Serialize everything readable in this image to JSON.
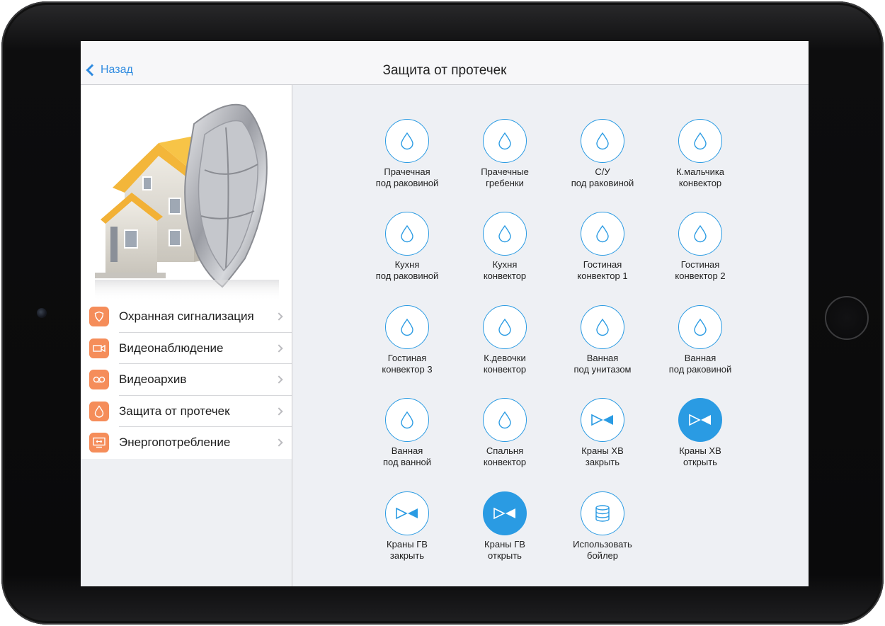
{
  "navbar": {
    "back_label": "Назад",
    "title": "Защита от протечек"
  },
  "sidebar": {
    "items": [
      {
        "label": "Охранная сигнализация",
        "icon": "shield-icon"
      },
      {
        "label": "Видеонаблюдение",
        "icon": "video-camera-icon"
      },
      {
        "label": "Видеоархив",
        "icon": "tape-icon"
      },
      {
        "label": "Защита от протечек",
        "icon": "water-drop-icon"
      },
      {
        "label": "Энергопотребление",
        "icon": "monitor-icon"
      }
    ]
  },
  "tiles": [
    {
      "line1": "Прачечная",
      "line2": "под раковиной",
      "icon": "water-drop-icon",
      "active": false
    },
    {
      "line1": "Прачечные",
      "line2": "гребенки",
      "icon": "water-drop-icon",
      "active": false
    },
    {
      "line1": "С/У",
      "line2": "под раковиной",
      "icon": "water-drop-icon",
      "active": false
    },
    {
      "line1": "К.мальчика",
      "line2": "конвектор",
      "icon": "water-drop-icon",
      "active": false
    },
    {
      "line1": "Кухня",
      "line2": "под раковиной",
      "icon": "water-drop-icon",
      "active": false
    },
    {
      "line1": "Кухня",
      "line2": "конвектор",
      "icon": "water-drop-icon",
      "active": false
    },
    {
      "line1": "Гостиная",
      "line2": "конвектор 1",
      "icon": "water-drop-icon",
      "active": false
    },
    {
      "line1": "Гостиная",
      "line2": "конвектор 2",
      "icon": "water-drop-icon",
      "active": false
    },
    {
      "line1": "Гостиная",
      "line2": "конвектор 3",
      "icon": "water-drop-icon",
      "active": false
    },
    {
      "line1": "К.девочки",
      "line2": "конвектор",
      "icon": "water-drop-icon",
      "active": false
    },
    {
      "line1": "Ванная",
      "line2": "под унитазом",
      "icon": "water-drop-icon",
      "active": false
    },
    {
      "line1": "Ванная",
      "line2": "под раковиной",
      "icon": "water-drop-icon",
      "active": false
    },
    {
      "line1": "Ванная",
      "line2": "под ванной",
      "icon": "water-drop-icon",
      "active": false
    },
    {
      "line1": "Спальня",
      "line2": "конвектор",
      "icon": "water-drop-icon",
      "active": false
    },
    {
      "line1": "Краны ХВ",
      "line2": "закрыть",
      "icon": "valve-icon",
      "active": false
    },
    {
      "line1": "Краны ХВ",
      "line2": "открыть",
      "icon": "valve-icon",
      "active": true
    },
    {
      "line1": "Краны ГВ",
      "line2": "закрыть",
      "icon": "valve-icon",
      "active": false
    },
    {
      "line1": "Краны ГВ",
      "line2": "открыть",
      "icon": "valve-icon",
      "active": true
    },
    {
      "line1": "Использовать",
      "line2": "бойлер",
      "icon": "database-icon",
      "active": false
    }
  ],
  "colors": {
    "accent": "#2a9be3",
    "menu_icon_bg": "#f58d5a",
    "back_link": "#2f8be0"
  }
}
